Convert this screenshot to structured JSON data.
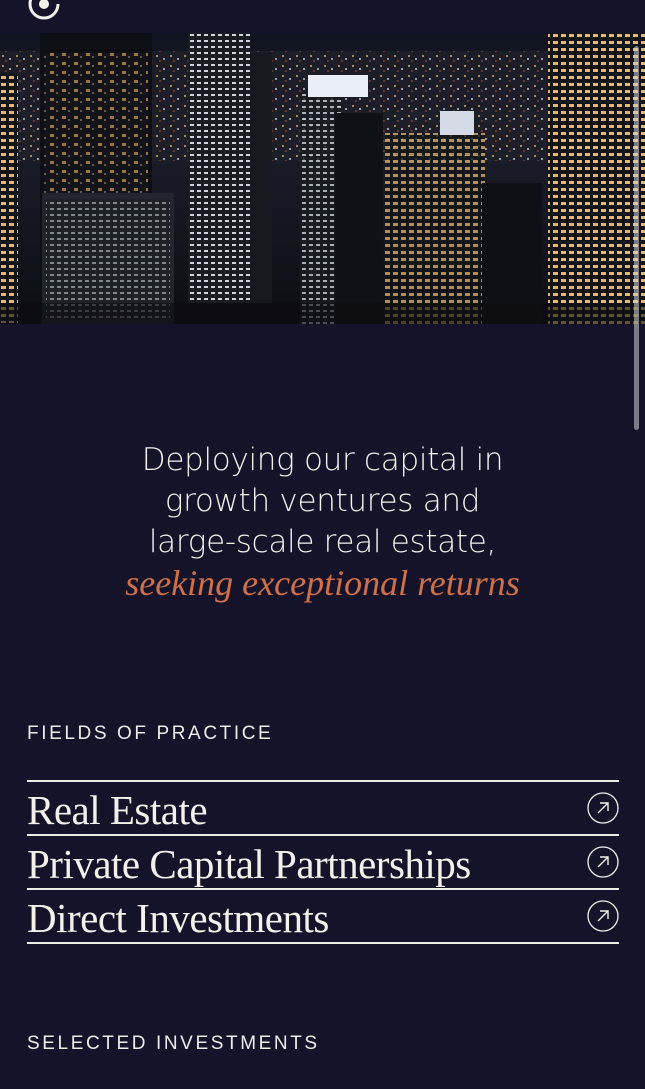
{
  "header": {
    "logo_icon": "brand-logo-icon"
  },
  "hero": {
    "image_subject": "night city skyline"
  },
  "tagline": {
    "lines": [
      "Deploying our capital in",
      "growth ventures and",
      "large-scale real estate,"
    ],
    "accent": "seeking exceptional returns"
  },
  "fields": {
    "title": "FIELDS OF PRACTICE",
    "items": [
      {
        "label": "Real Estate",
        "icon": "arrow-up-right-icon"
      },
      {
        "label": "Private Capital Partnerships",
        "icon": "arrow-up-right-icon"
      },
      {
        "label": "Direct Investments",
        "icon": "arrow-up-right-icon"
      }
    ]
  },
  "investments": {
    "title": "SELECTED INVESTMENTS"
  },
  "colors": {
    "background": "#15132a",
    "text": "#f3f1ea",
    "accent": "#cf7049"
  }
}
